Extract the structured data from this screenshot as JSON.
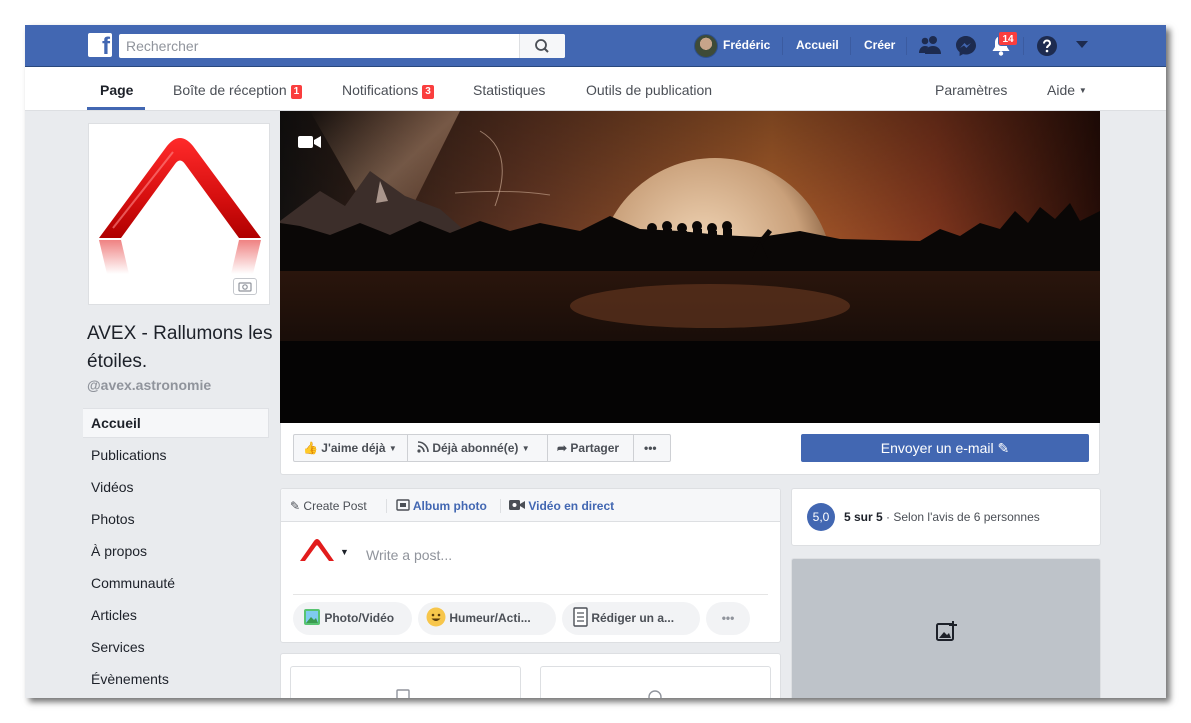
{
  "topbar": {
    "search_placeholder": "Rechercher",
    "user_name": "Frédéric",
    "home_label": "Accueil",
    "create_label": "Créer",
    "notification_count": "14"
  },
  "page_nav": {
    "tabs": [
      {
        "label": "Page",
        "active": true
      },
      {
        "label": "Boîte de réception",
        "badge": "1"
      },
      {
        "label": "Notifications",
        "badge": "3"
      },
      {
        "label": "Statistiques"
      },
      {
        "label": "Outils de publication"
      }
    ],
    "settings_label": "Paramètres",
    "help_label": "Aide"
  },
  "page": {
    "name": "AVEX - Rallumons les étoiles.",
    "handle": "@avex.astronomie"
  },
  "sidebar": {
    "items": [
      {
        "label": "Accueil",
        "active": true
      },
      {
        "label": "Publications"
      },
      {
        "label": "Vidéos"
      },
      {
        "label": "Photos"
      },
      {
        "label": "À propos"
      },
      {
        "label": "Communauté"
      },
      {
        "label": "Articles"
      },
      {
        "label": "Services"
      },
      {
        "label": "Évènements"
      }
    ]
  },
  "actions": {
    "like_label": "J'aime déjà",
    "follow_label": "Déjà abonné(e)",
    "share_label": "Partager",
    "more_label": "•••",
    "email_label": "Envoyer un e-mail"
  },
  "composer": {
    "tabs": [
      {
        "label": "Create Post"
      },
      {
        "label": "Album photo"
      },
      {
        "label": "Vidéo en direct"
      }
    ],
    "placeholder": "Write a post...",
    "pills": [
      {
        "label": "Photo/Vidéo"
      },
      {
        "label": "Humeur/Acti..."
      },
      {
        "label": "Rédiger un a..."
      }
    ],
    "more_label": "•••"
  },
  "rating": {
    "score": "5,0",
    "out_of": "5 sur 5",
    "detail": "· Selon l'avis de 6 personnes"
  },
  "colors": {
    "brand_blue": "#4267b2",
    "badge_red": "#fa3e3e",
    "logo_red": "#e21c1c"
  },
  "icons": [
    "facebook-logo",
    "search-icon",
    "friends-icon",
    "messenger-icon",
    "bell-icon",
    "help-icon",
    "caret-down-icon",
    "camera-icon",
    "video-camera-icon",
    "thumbs-up-icon",
    "rss-icon",
    "share-arrow-icon",
    "pencil-icon",
    "photo-album-icon",
    "live-video-icon",
    "photo-icon",
    "smiley-icon",
    "notebook-icon",
    "add-photo-icon"
  ]
}
